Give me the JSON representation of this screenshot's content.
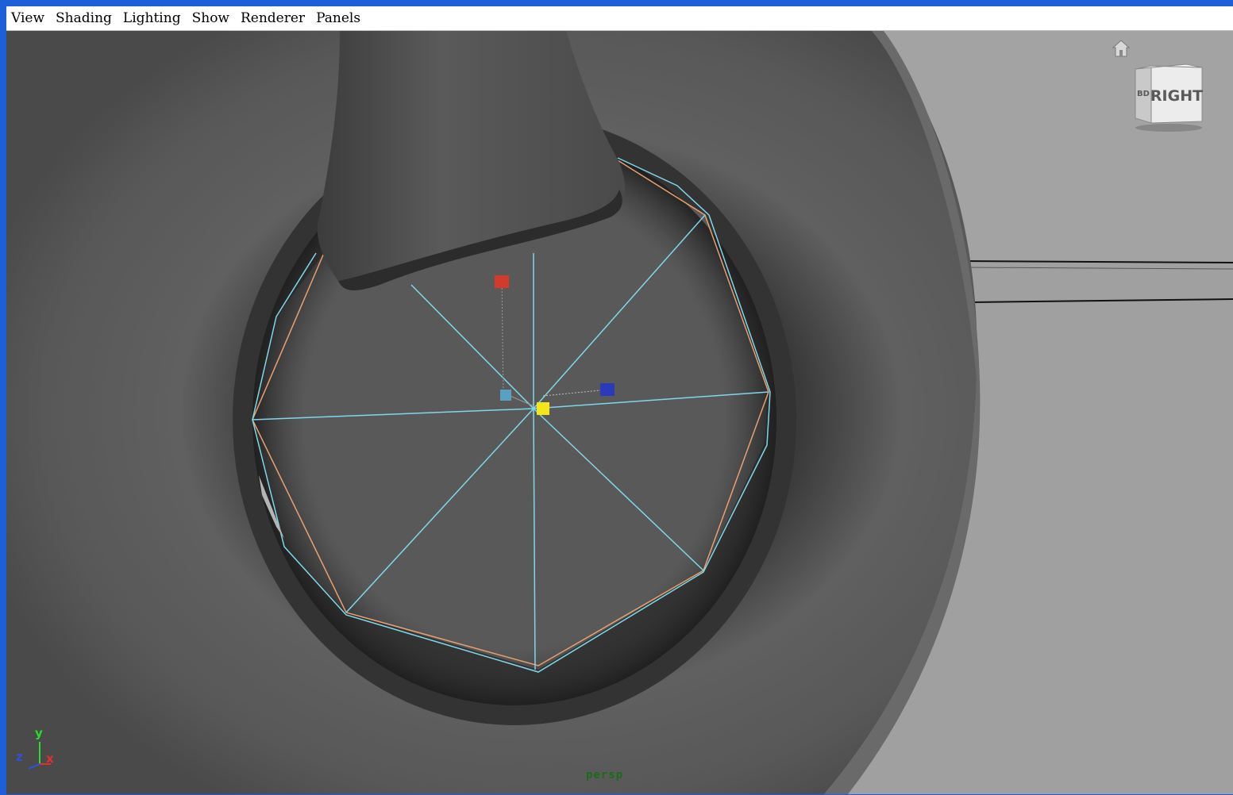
{
  "menubar": {
    "items": [
      "View",
      "Shading",
      "Lighting",
      "Show",
      "Renderer",
      "Panels"
    ]
  },
  "viewport": {
    "camera_label": "persp",
    "viewcube_face": "RIGHT",
    "viewcube_side": "BD",
    "axis": {
      "y": "y",
      "z": "z",
      "x": "x"
    },
    "icons": {
      "home": "home-icon",
      "viewcube": "view-cube-icon"
    }
  },
  "colors": {
    "frame_blue": "#1c5fd8",
    "background": "#a0a0a0",
    "mesh": "#5f5f5f",
    "wire_selected": "#7fd8ea",
    "edge_highlight": "#e9a070",
    "manip_red": "#d23a2a",
    "manip_blue": "#2a3ab8",
    "manip_cyan": "#5aa0c0",
    "manip_yellow": "#f2e51b",
    "camera_label": "#1b6b1b"
  }
}
